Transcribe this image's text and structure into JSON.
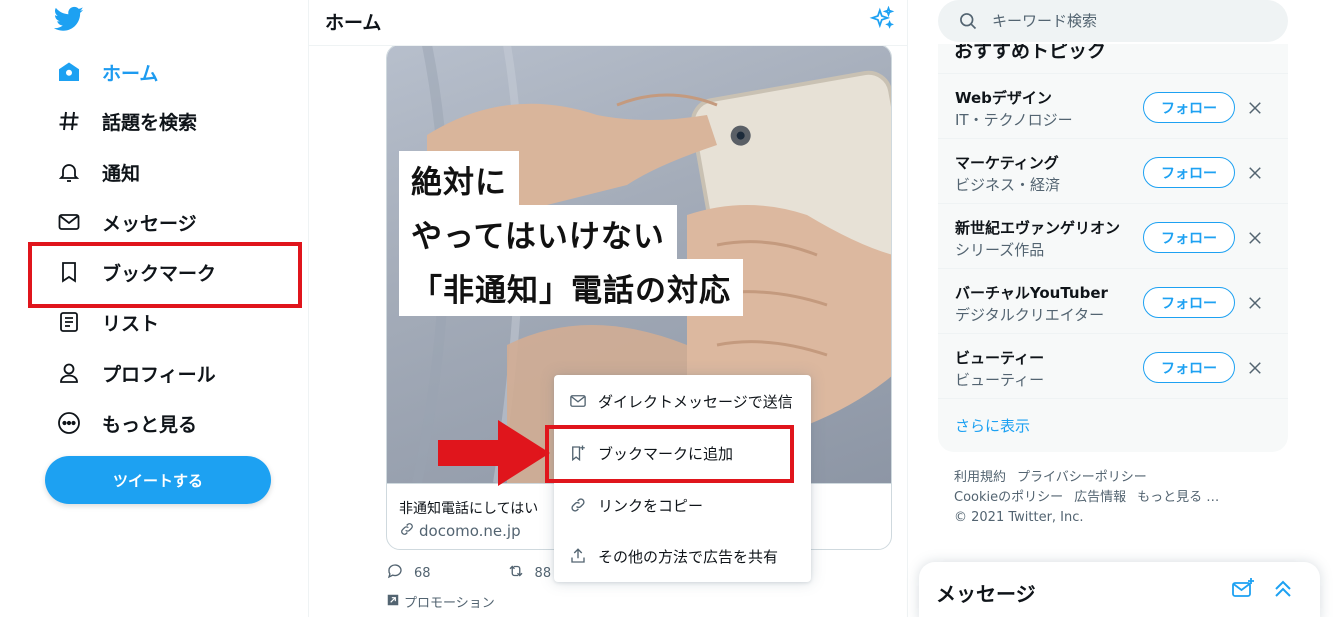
{
  "colors": {
    "brand": "#1da1f2",
    "highlight": "#e0151c",
    "text": "#0f1419",
    "muted": "#536471"
  },
  "sidebar": {
    "logo_icon": "twitter-bird-icon",
    "items": [
      {
        "label": "ホーム",
        "icon": "home-icon",
        "active": true
      },
      {
        "label": "話題を検索",
        "icon": "hashtag-icon"
      },
      {
        "label": "通知",
        "icon": "bell-icon"
      },
      {
        "label": "メッセージ",
        "icon": "envelope-icon"
      },
      {
        "label": "ブックマーク",
        "icon": "bookmark-icon"
      },
      {
        "label": "リスト",
        "icon": "list-icon"
      },
      {
        "label": "プロフィール",
        "icon": "person-icon"
      },
      {
        "label": "もっと見る",
        "icon": "more-icon"
      }
    ],
    "tweet_button": "ツイートする"
  },
  "main": {
    "title": "ホーム",
    "card": {
      "image_lines": [
        "絶対に",
        "やってはいけない",
        "「非通知」電話の対応"
      ],
      "description": "非通知電話にしてはい",
      "domain": "docomo.ne.jp"
    },
    "stats": {
      "replies": "68",
      "retweets": "88"
    },
    "promotion": "プロモーション",
    "menu": [
      {
        "label": "ダイレクトメッセージで送信",
        "icon": "envelope-icon"
      },
      {
        "label": "ブックマークに追加",
        "icon": "bookmark-add-icon"
      },
      {
        "label": "リンクをコピー",
        "icon": "link-icon"
      },
      {
        "label": "その他の方法で広告を共有",
        "icon": "share-icon"
      }
    ]
  },
  "right": {
    "search_placeholder": "キーワード検索",
    "topics_title": "おすすめトピック",
    "topics": [
      {
        "name": "Webデザイン",
        "category": "IT・テクノロジー"
      },
      {
        "name": "マーケティング",
        "category": "ビジネス・経済"
      },
      {
        "name": "新世紀エヴァンゲリオン",
        "category": "シリーズ作品"
      },
      {
        "name": "バーチャルYouTuber",
        "category": "デジタルクリエイター"
      },
      {
        "name": "ビューティー",
        "category": "ビューティー"
      }
    ],
    "follow_label": "フォロー",
    "show_more": "さらに表示",
    "footer": {
      "links_row1": [
        "利用規約",
        "プライバシーポリシー"
      ],
      "links_row2": [
        "Cookieのポリシー",
        "広告情報",
        "もっと見る …"
      ],
      "copyright": "© 2021 Twitter, Inc."
    },
    "messages_drawer": "メッセージ"
  }
}
